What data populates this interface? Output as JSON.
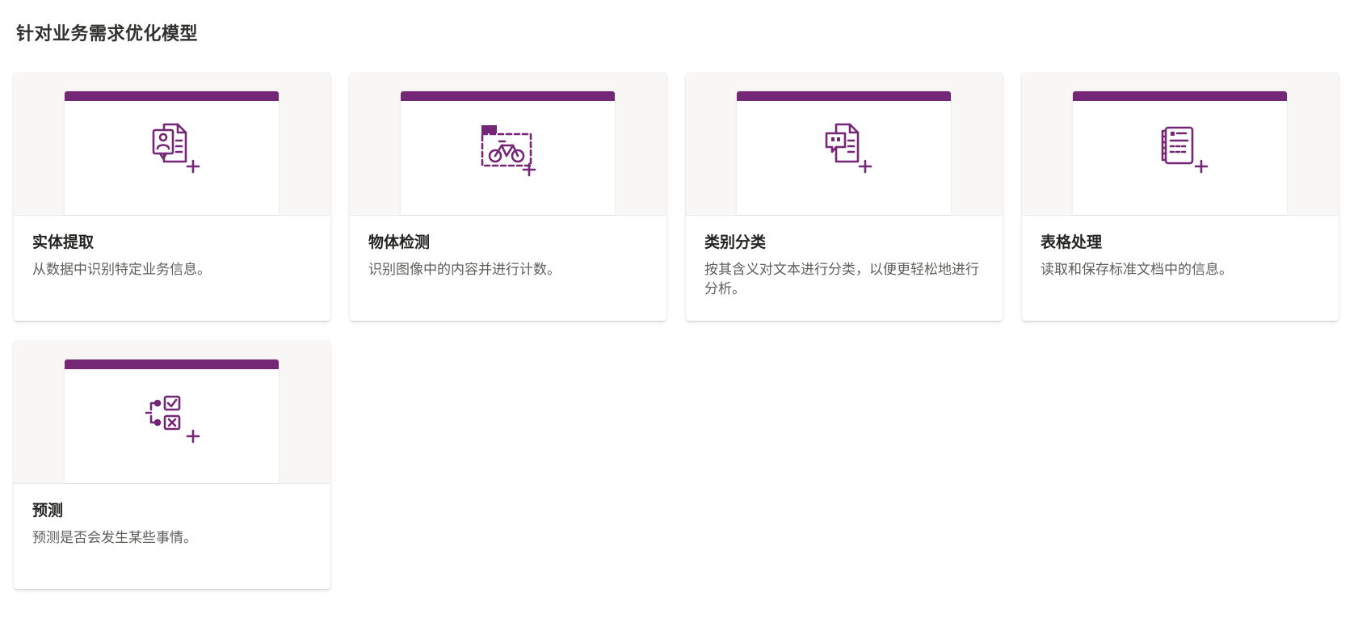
{
  "section": {
    "title": "针对业务需求优化模型"
  },
  "colors": {
    "accent": "#742774",
    "art_background": "#f8f7f6"
  },
  "cards": [
    {
      "title": "实体提取",
      "description": "从数据中识别特定业务信息。",
      "icon": "entity-extraction-icon"
    },
    {
      "title": "物体检测",
      "description": "识别图像中的内容并进行计数。",
      "icon": "object-detection-icon"
    },
    {
      "title": "类别分类",
      "description": "按其含义对文本进行分类，以便更轻松地进行分析。",
      "icon": "category-classification-icon"
    },
    {
      "title": "表格处理",
      "description": "读取和保存标准文档中的信息。",
      "icon": "form-processing-icon"
    },
    {
      "title": "预测",
      "description": "预测是否会发生某些事情。",
      "icon": "prediction-icon"
    }
  ]
}
